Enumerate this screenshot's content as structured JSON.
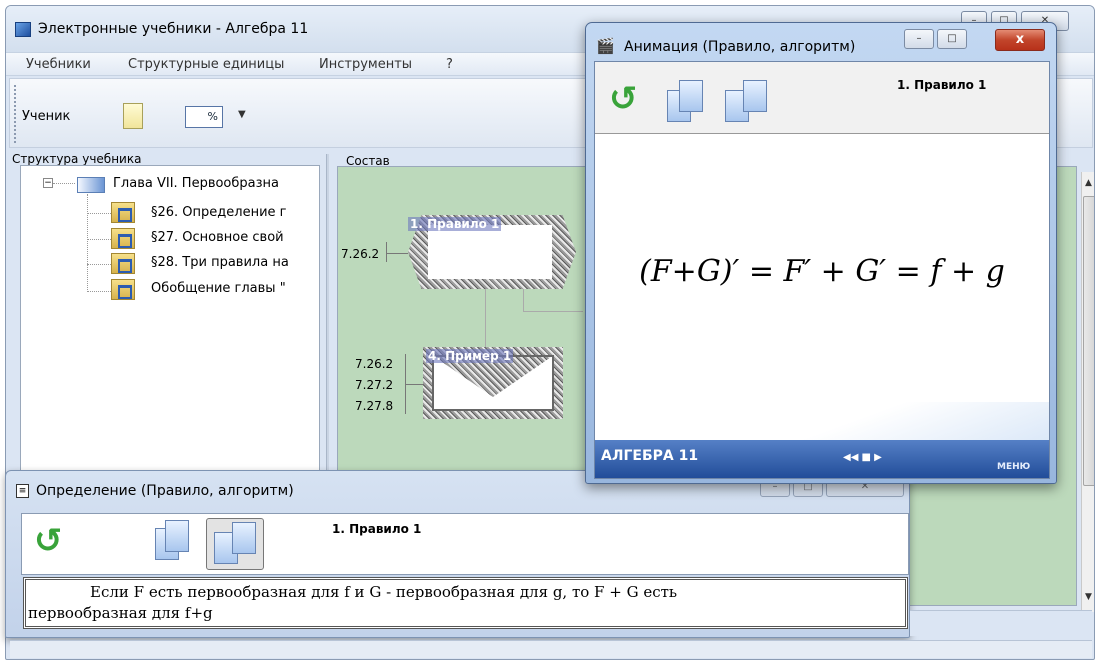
{
  "main_window": {
    "title": "Электронные учебники - Алгебра 11",
    "caption_buttons": [
      "–",
      "□",
      "✕"
    ]
  },
  "menu": [
    "Учебники",
    "Структурные единицы",
    "Инструменты",
    "?"
  ],
  "toolbar": {
    "student_label": "Ученик",
    "percent_icon": "%"
  },
  "structure_pane": {
    "label": "Структура учебника",
    "chapter": "Глава VII. Первообразна",
    "items": [
      "§26. Определение г",
      "§27. Основное свой",
      "§28. Три правила на",
      "Обобщение главы \""
    ]
  },
  "composition_pane": {
    "label": "Состав",
    "nodes": [
      {
        "label": "1. Правило 1",
        "refs": [
          "7.26.2"
        ]
      },
      {
        "label": "4. Пример 1",
        "refs": [
          "7.26.2",
          "7.27.2",
          "7.27.8"
        ]
      }
    ]
  },
  "definition_window": {
    "title": "Определение (Правило, алгоритм)",
    "caption_buttons": [
      "–",
      "□",
      "✕"
    ],
    "heading": "1. Правило 1",
    "text_line1": "Если F есть первообразная для f и G - первообразная для g, то F + G есть",
    "text_line2": "первообразная для f+g"
  },
  "animation_window": {
    "title": "Анимация (Правило, алгоритм)",
    "caption_buttons": [
      "–",
      "□",
      "x"
    ],
    "heading": "1. Правило 1",
    "formula": "(F+G)′ = F′ + G′ = f + g",
    "footer_brand": "АЛГЕБРА 11",
    "footer_controls": "◀◀ ■ ▶",
    "footer_menu": "МЕНЮ"
  },
  "colors": {
    "composition_bg": "#bcd9bb",
    "window_chrome": "#c3d8f2",
    "close_button": "#c2452b",
    "footer_band": "#1f4a97"
  }
}
